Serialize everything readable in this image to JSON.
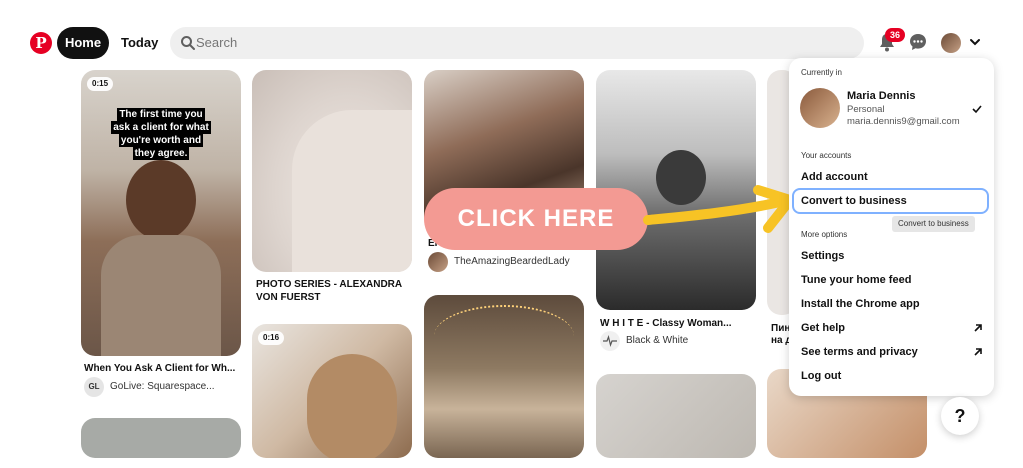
{
  "header": {
    "logo_letter": "P",
    "home_label": "Home",
    "today_label": "Today",
    "search_placeholder": "Search",
    "notification_count": "36"
  },
  "pins": [
    {
      "badge": "0:15",
      "caption": "The first time you ask a client for what you're worth and they agree.",
      "title": "When You Ask A Client for Wh...",
      "source_avatar": "GL",
      "source": "GoLive: Squarespace..."
    },
    {
      "title": "PHOTO SERIES - ALEXANDRA VON FUERST"
    },
    {
      "badge": "0:16"
    },
    {
      "title_fragment": "Er",
      "source": "TheAmazingBeardedLady"
    },
    {
      "title": "W H I T E - Classy Woman...",
      "source": "Black & White"
    },
    {
      "title_fragment_1": "Пин",
      "title_fragment_2": "на д"
    }
  ],
  "cta": {
    "label": "CLICK HERE"
  },
  "account_menu": {
    "currently_in_label": "Currently in",
    "account": {
      "name": "Maria Dennis",
      "type": "Personal",
      "email": "maria.dennis9@gmail.com"
    },
    "your_accounts_label": "Your accounts",
    "add_account": "Add account",
    "convert_to_business": "Convert to business",
    "tooltip": "Convert to business",
    "more_options_label": "More options",
    "items": [
      "Settings",
      "Tune your home feed",
      "Install the Chrome app",
      "Get help",
      "See terms and privacy",
      "Log out"
    ]
  },
  "help_button": "?",
  "colors": {
    "brand": "#e60023",
    "cta": "#f39a93",
    "arrow": "#f7c325",
    "focus": "#7fb1ff"
  }
}
